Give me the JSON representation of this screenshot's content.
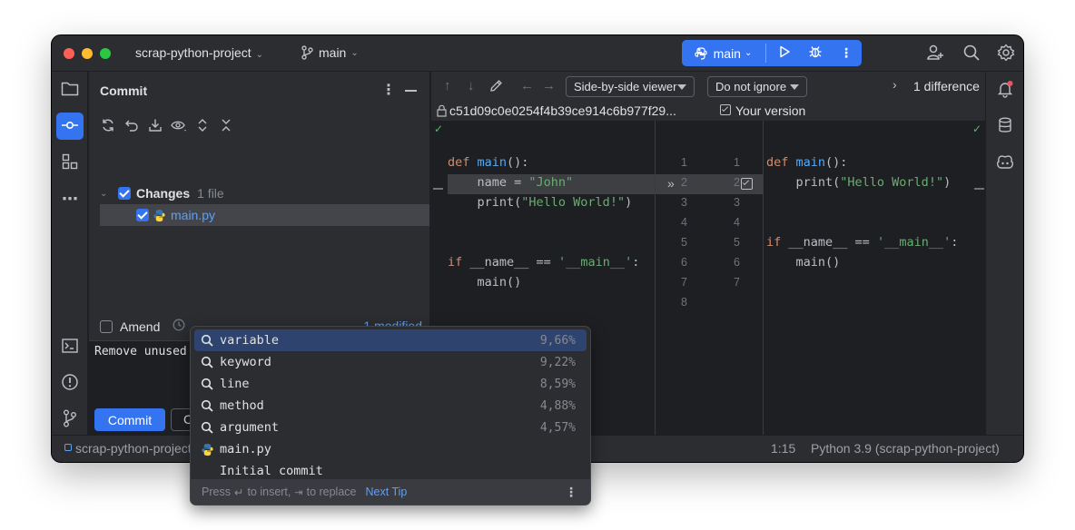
{
  "titlebar": {
    "project": "scrap-python-project",
    "branch": "main",
    "run_config": "main"
  },
  "commit_panel": {
    "title": "Commit",
    "changes_label": "Changes",
    "changes_count": "1 file",
    "file_name": "main.py",
    "amend_label": "Amend",
    "modified_label": "1 modified",
    "message": "Remove unused",
    "commit_button": "Commit",
    "second_button": "C"
  },
  "diff": {
    "viewer_mode": "Side-by-side viewer",
    "ignore_mode": "Do not ignore",
    "difference_count": "1 difference",
    "left_hash": "c51d09c0e0254f4b39ce914c6b977f29...",
    "right_title": "Your version",
    "left_lines": [
      {
        "num": "1",
        "parts": [
          [
            "kw",
            "def "
          ],
          [
            "fn",
            "main"
          ],
          [
            "pl",
            "():"
          ]
        ]
      },
      {
        "num": "2",
        "parts": [
          [
            "pl",
            "    name = "
          ],
          [
            "str",
            "\"John\""
          ]
        ]
      },
      {
        "num": "3",
        "parts": [
          [
            "pl",
            "    print("
          ],
          [
            "str",
            "\"Hello World!\""
          ],
          [
            "pl",
            ")"
          ]
        ]
      },
      {
        "num": "4",
        "parts": []
      },
      {
        "num": "5",
        "parts": []
      },
      {
        "num": "6",
        "parts": [
          [
            "kw",
            "if "
          ],
          [
            "pl",
            "__name__ == "
          ],
          [
            "str",
            "'__main__'"
          ],
          [
            "pl",
            ":"
          ]
        ]
      },
      {
        "num": "7",
        "parts": [
          [
            "pl",
            "    main()"
          ]
        ]
      },
      {
        "num": "8",
        "parts": []
      }
    ],
    "right_lines": [
      {
        "num": "1",
        "parts": [
          [
            "kw",
            "def "
          ],
          [
            "fn",
            "main"
          ],
          [
            "pl",
            "():"
          ]
        ]
      },
      {
        "num": "2",
        "parts": [
          [
            "pl",
            "    print("
          ],
          [
            "str",
            "\"Hello World!\""
          ],
          [
            "pl",
            ")"
          ]
        ]
      },
      {
        "num": "3",
        "parts": []
      },
      {
        "num": "4",
        "parts": []
      },
      {
        "num": "5",
        "parts": [
          [
            "kw",
            "if "
          ],
          [
            "pl",
            "__name__ == "
          ],
          [
            "str",
            "'__main__'"
          ],
          [
            "pl",
            ":"
          ]
        ]
      },
      {
        "num": "6",
        "parts": [
          [
            "pl",
            "    main()"
          ]
        ]
      },
      {
        "num": "7",
        "parts": []
      }
    ]
  },
  "statusbar": {
    "project": "scrap-python-project",
    "position": "1:15",
    "interpreter": "Python 3.9 (scrap-python-project)"
  },
  "completion": {
    "items": [
      {
        "label": "variable",
        "pct": "9,66%",
        "icon": "search-icon"
      },
      {
        "label": "keyword",
        "pct": "9,22%",
        "icon": "search-icon"
      },
      {
        "label": "line",
        "pct": "8,59%",
        "icon": "search-icon"
      },
      {
        "label": "method",
        "pct": "4,88%",
        "icon": "search-icon"
      },
      {
        "label": "argument",
        "pct": "4,57%",
        "icon": "search-icon"
      },
      {
        "label": "main.py",
        "pct": "",
        "icon": "python-file-icon"
      },
      {
        "label": "Initial commit",
        "pct": "",
        "icon": ""
      }
    ],
    "footer_press": "Press",
    "footer_insert": "to insert,",
    "footer_replace": "to replace",
    "footer_tip": "Next Tip"
  },
  "colors": {
    "accent": "#3574f0",
    "background": "#1e1f22",
    "panel": "#2b2d30",
    "keyword": "#cf8e6d",
    "function": "#56a8f5",
    "string": "#6aab73"
  }
}
